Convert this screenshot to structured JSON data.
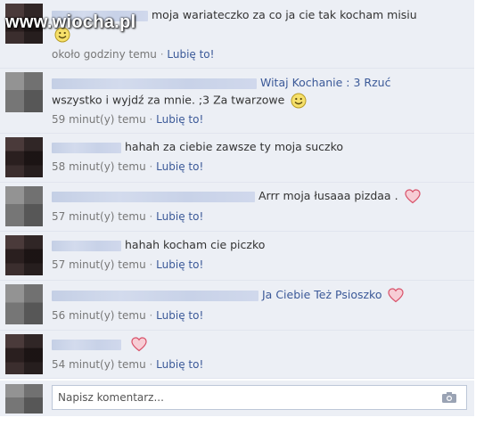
{
  "watermark": "www.wiocha.pl",
  "like_label": "Lubię to!",
  "separator": "·",
  "comments": [
    {
      "text_prefix": "",
      "text": "moja wariateczko za co ja cie tak kocham misiu",
      "text2": "",
      "time": "około godziny temu",
      "emoji": "smile-icon",
      "avatar": "dark"
    },
    {
      "text": "Witaj Kochanie : 3 Rzuć",
      "text2": "wszystko i wyjdź za mnie. ;3 Za twarzowe",
      "time": "59 minut(y) temu",
      "emoji": "smile-icon",
      "avatar": "gray"
    },
    {
      "text": "hahah za ciebie zawsze ty moja suczko",
      "time": "58 minut(y) temu",
      "avatar": "dark"
    },
    {
      "text": "Arrr moja łusaaa pizdaa .",
      "time": "57 minut(y) temu",
      "emoji": "heart-icon",
      "avatar": "gray"
    },
    {
      "text": "hahah kocham cie piczko",
      "time": "57 minut(y) temu",
      "avatar": "dark"
    },
    {
      "text": "Ja Ciebie Też Psioszko",
      "time": "56 minut(y) temu",
      "emoji": "heart-icon",
      "avatar": "gray"
    },
    {
      "text": "",
      "time": "54 minut(y) temu",
      "emoji": "heart-icon",
      "avatar": "dark"
    }
  ],
  "compose": {
    "placeholder": "Napisz komentarz...",
    "icon": "camera-icon"
  }
}
